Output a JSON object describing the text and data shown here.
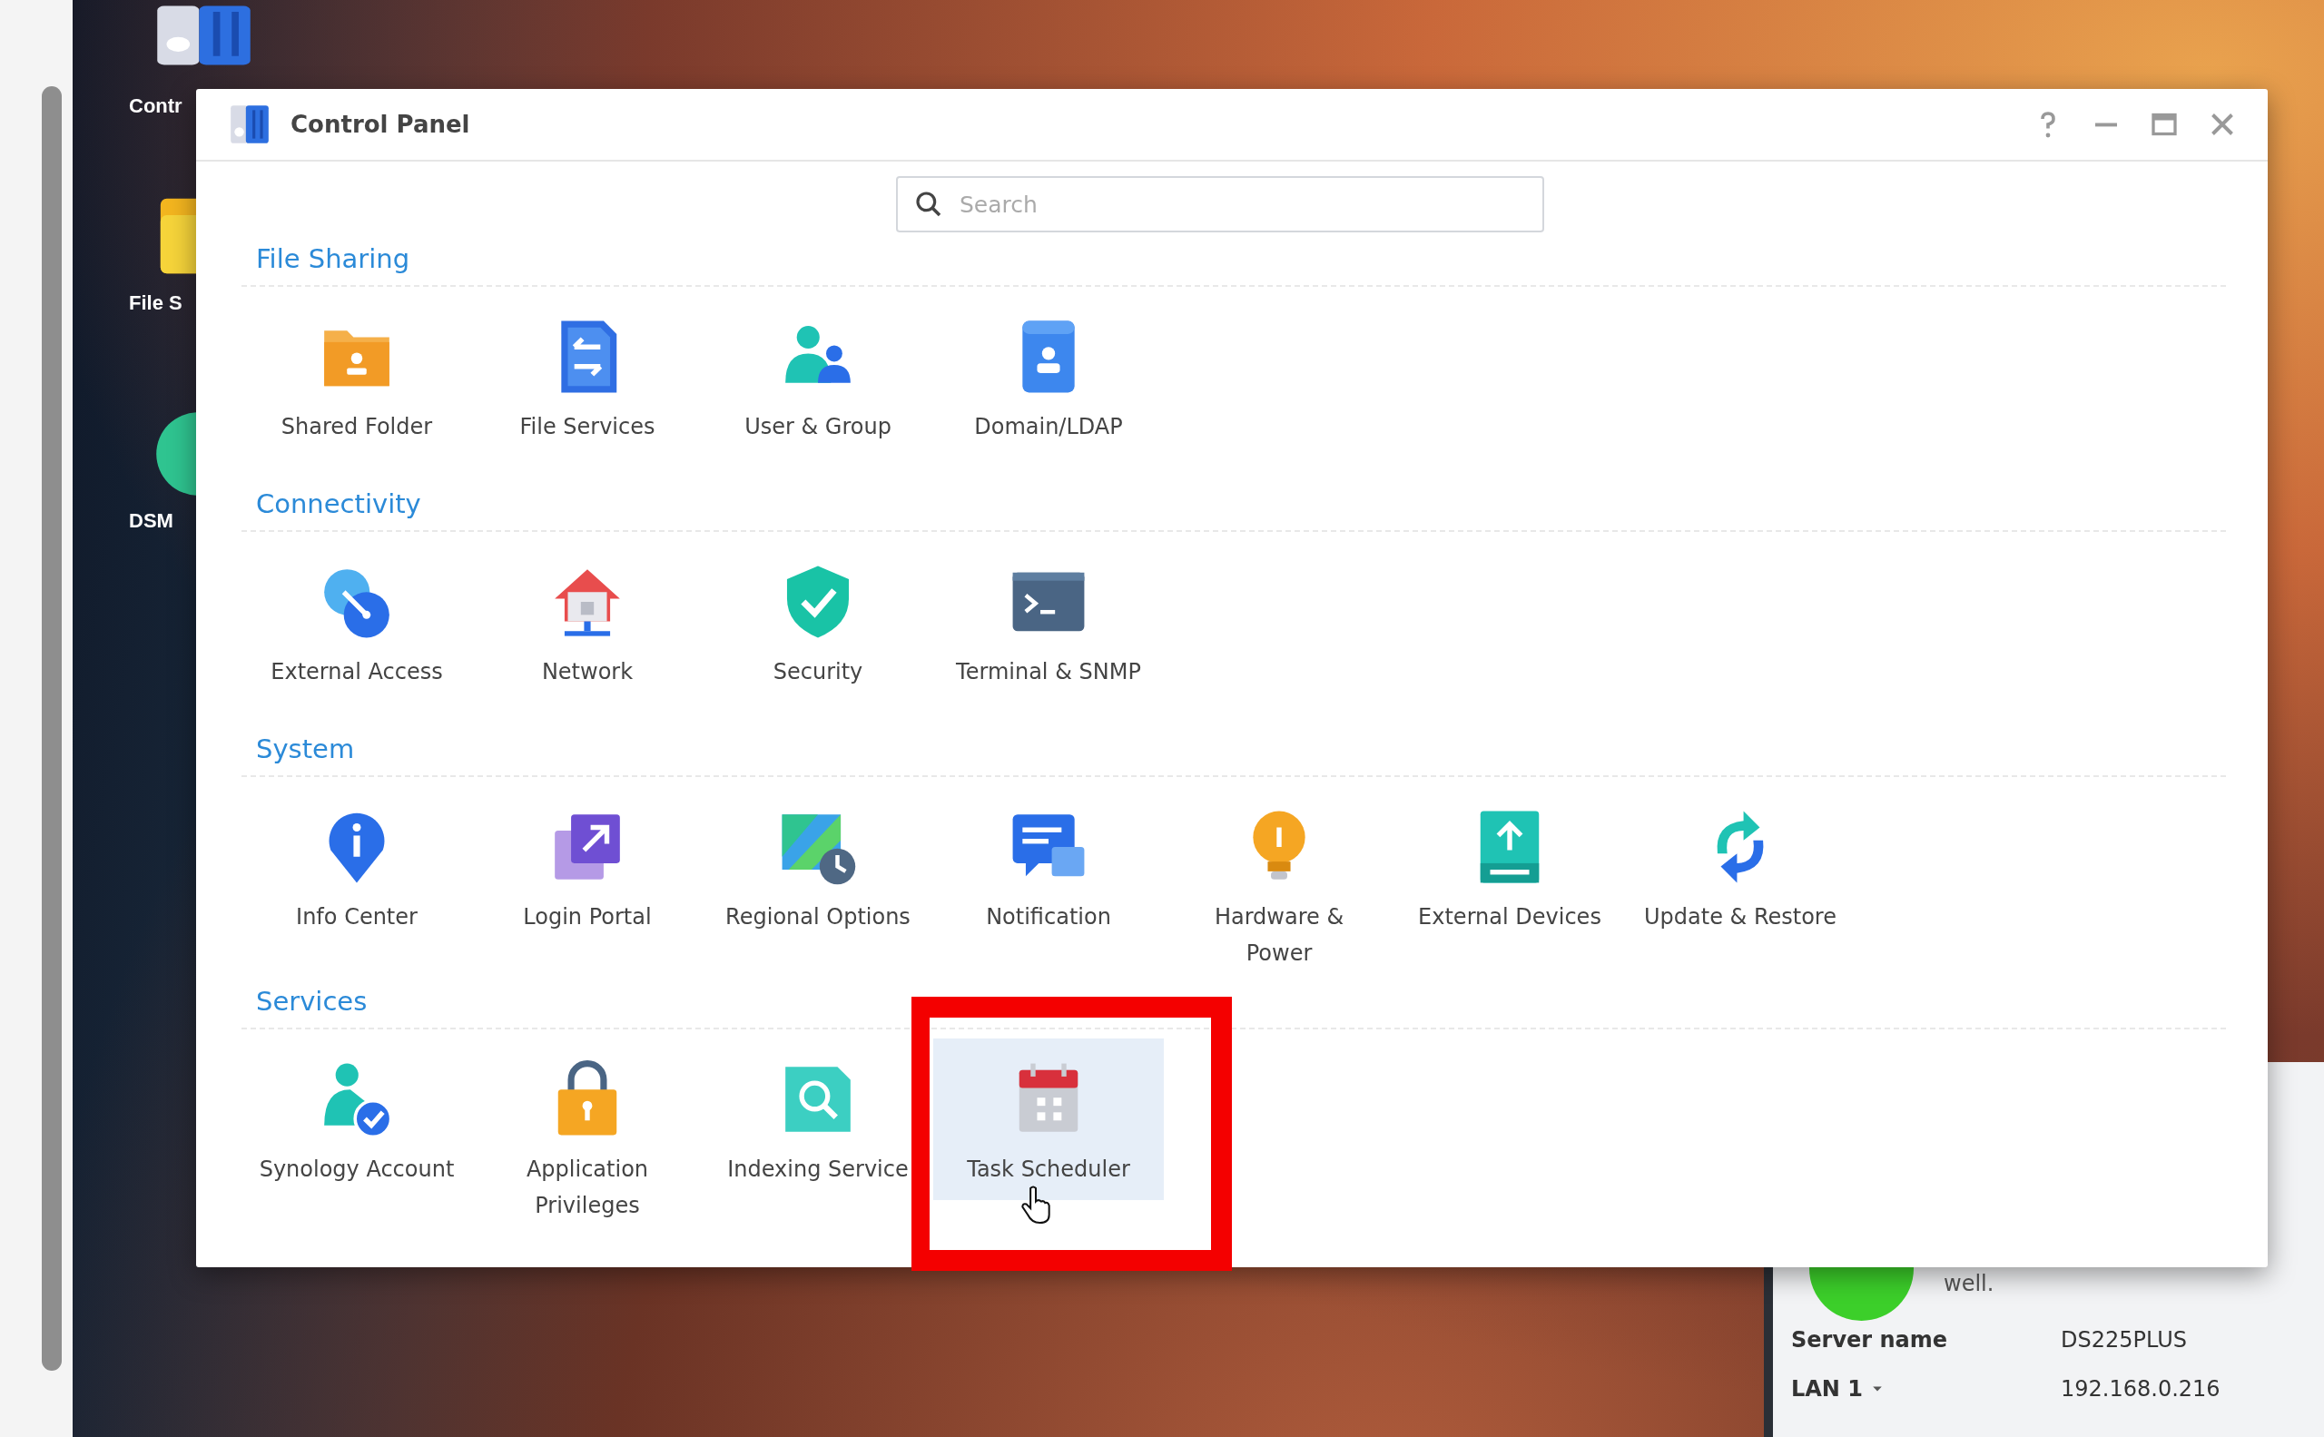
{
  "desktop": {
    "icons": [
      {
        "label": "Contr",
        "kind": "panel"
      },
      {
        "label": "File S",
        "kind": "folder"
      },
      {
        "label": "DSM",
        "kind": "round"
      }
    ]
  },
  "window": {
    "title": "Control Panel",
    "search": {
      "placeholder": "Search"
    },
    "sections": [
      {
        "title": "File Sharing",
        "items": [
          {
            "label": "Shared Folder",
            "kind": "shared-folder",
            "selected": false,
            "annotated": false
          },
          {
            "label": "File Services",
            "kind": "file-services",
            "selected": false,
            "annotated": false
          },
          {
            "label": "User & Group",
            "kind": "users",
            "selected": false,
            "annotated": false
          },
          {
            "label": "Domain/LDAP",
            "kind": "domain",
            "selected": false,
            "annotated": false
          }
        ]
      },
      {
        "title": "Connectivity",
        "items": [
          {
            "label": "External Access",
            "kind": "external-access",
            "selected": false,
            "annotated": false
          },
          {
            "label": "Network",
            "kind": "network",
            "selected": false,
            "annotated": false
          },
          {
            "label": "Security",
            "kind": "security",
            "selected": false,
            "annotated": false
          },
          {
            "label": "Terminal & SNMP",
            "kind": "terminal",
            "selected": false,
            "annotated": false
          }
        ]
      },
      {
        "title": "System",
        "items": [
          {
            "label": "Info Center",
            "kind": "info",
            "selected": false,
            "annotated": false
          },
          {
            "label": "Login Portal",
            "kind": "login-portal",
            "selected": false,
            "annotated": false
          },
          {
            "label": "Regional Options",
            "kind": "regional",
            "selected": false,
            "annotated": false
          },
          {
            "label": "Notification",
            "kind": "notification",
            "selected": false,
            "annotated": false
          },
          {
            "label": "Hardware &\nPower",
            "kind": "hardware",
            "selected": false,
            "annotated": false
          },
          {
            "label": "External Devices",
            "kind": "external-devices",
            "selected": false,
            "annotated": false
          },
          {
            "label": "Update & Restore",
            "kind": "update",
            "selected": false,
            "annotated": false
          }
        ]
      },
      {
        "title": "Services",
        "items": [
          {
            "label": "Synology Account",
            "kind": "account",
            "selected": false,
            "annotated": false
          },
          {
            "label": "Application\nPrivileges",
            "kind": "privileges",
            "selected": false,
            "annotated": false
          },
          {
            "label": "Indexing Service",
            "kind": "indexing",
            "selected": false,
            "annotated": false
          },
          {
            "label": "Task Scheduler",
            "kind": "calendar",
            "selected": true,
            "annotated": true
          }
        ]
      }
    ]
  },
  "widget": {
    "status_text": "well.",
    "rows": [
      {
        "label": "Server name",
        "value": "DS225PLUS",
        "has_menu": false
      },
      {
        "label": "LAN 1",
        "value": "192.168.0.216",
        "has_menu": true
      }
    ]
  }
}
